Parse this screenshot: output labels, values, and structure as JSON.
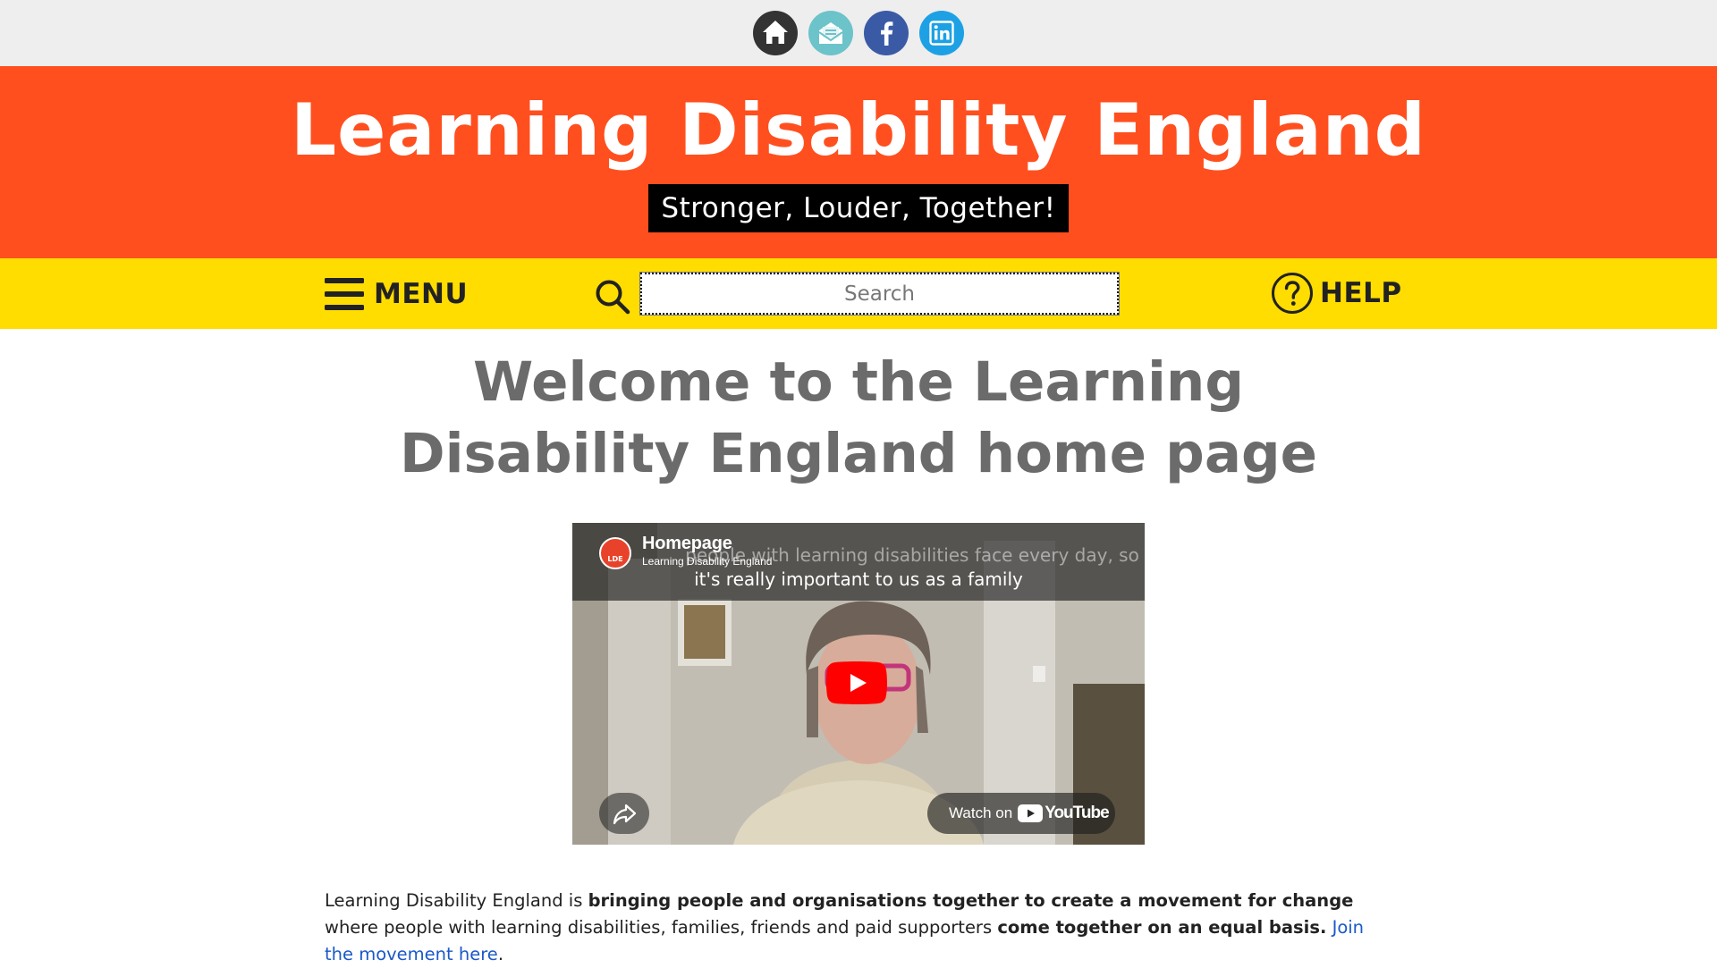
{
  "social": {
    "items": [
      {
        "name": "home",
        "icon": "home-icon",
        "color": "#333333"
      },
      {
        "name": "email",
        "icon": "email-icon",
        "color": "#6cc3c9"
      },
      {
        "name": "facebook",
        "icon": "facebook-icon",
        "color": "#3b5aa6"
      },
      {
        "name": "linkedin",
        "icon": "linkedin-icon",
        "color": "#1da1e4"
      }
    ]
  },
  "banner": {
    "title": "Learning Disability England",
    "tagline": "Stronger, Louder, Together!",
    "color": "#ff4f1f"
  },
  "nav": {
    "menu_label": "MENU",
    "search_placeholder": "Search",
    "help_label": "HELP",
    "color": "#ffdd00"
  },
  "main": {
    "heading": "Welcome to the Learning Disability England home page",
    "video": {
      "title": "Homepage",
      "channel": "Learning Disability England",
      "channel_badge": "LDE",
      "caption_line_1": "people with learning disabilities face every day, so",
      "caption_line_2": "it's really important to us as a family",
      "watch_on_label": "Watch on",
      "youtube_label": "YouTube"
    },
    "intro": {
      "part1": "Learning Disability England is ",
      "bold1": "bringing people and organisations together to create a movement for change",
      "part2": " where people with learning disabilities, families, friends and paid supporters ",
      "bold2": "come together on an equal basis.",
      "link_text": "Join the movement here",
      "end": "."
    }
  }
}
